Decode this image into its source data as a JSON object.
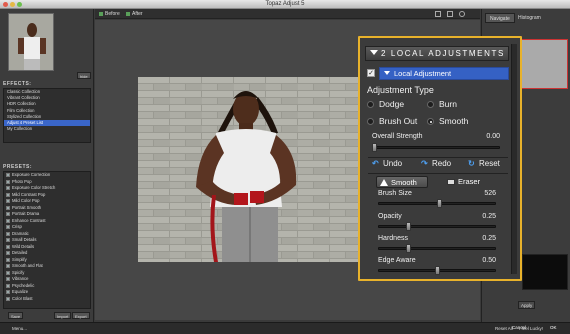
{
  "window": {
    "title": "Topaz Adjust 5"
  },
  "toolbar": {
    "before_label": "Before",
    "after_label": "After"
  },
  "left": {
    "hide_label": "hide",
    "effects_header": "EFFECTS:",
    "effects": [
      "Classic Collection",
      "Vibrant Collection",
      "HDR Collection",
      "Film Collection",
      "Stylized Collection",
      "Adjust 4 Preset List",
      "My Collection"
    ],
    "effects_selected_index": 5,
    "presets_header": "PRESETS:",
    "presets": [
      "Exposure Correction",
      "Photo Pop",
      "Exposure Color Stretch",
      "Mild Contrast Pop",
      "Mild Color Pop",
      "Portrait Smooth",
      "Portrait Drama",
      "Enhance Contrast",
      "Crisp",
      "Dramatic",
      "Small Details",
      "Wild Details",
      "Detailed",
      "Simplify",
      "Smooth and Flat",
      "Spicify",
      "Vibrance",
      "Psychedelic",
      "Equalize",
      "Color Blast"
    ],
    "save_label": "Save",
    "import_label": "Import",
    "export_label": "Export",
    "menu_label": "Menu..."
  },
  "right": {
    "tab_navigate": "Navigate",
    "tab_histogram": "Histogram",
    "apply_label": "Apply",
    "reset_all_label": "Reset All",
    "feel_lucky_label": "I feel Lucky!",
    "cancel_label": "Cancel",
    "ok_label": "OK",
    "partial_labels": [
      "5.00",
      "ooth",
      "set",
      "ser",
      "et",
      "ser"
    ]
  },
  "local": {
    "header": "2 LOCAL ADJUSTMENTS",
    "local_adjustment": "Local Adjustment",
    "adjustment_type": "Adjustment Type",
    "dodge": "Dodge",
    "burn": "Burn",
    "brush_out": "Brush Out",
    "smooth": "Smooth",
    "selected_type": "Smooth",
    "overall_strength_label": "Overall Strength",
    "overall_strength_value": "0.00",
    "undo": "Undo",
    "redo": "Redo",
    "reset": "Reset",
    "tool_smooth": "Smooth",
    "tool_eraser": "Eraser",
    "active_tool": "Smooth",
    "params": [
      {
        "label": "Brush Size",
        "value": "526",
        "fraction": 0.52
      },
      {
        "label": "Opacity",
        "value": "0.25",
        "fraction": 0.25
      },
      {
        "label": "Hardness",
        "value": "0.25",
        "fraction": 0.25
      },
      {
        "label": "Edge Aware",
        "value": "0.50",
        "fraction": 0.5
      }
    ]
  },
  "colors": {
    "accent": "#e8b22b",
    "selection": "#3561c4"
  }
}
